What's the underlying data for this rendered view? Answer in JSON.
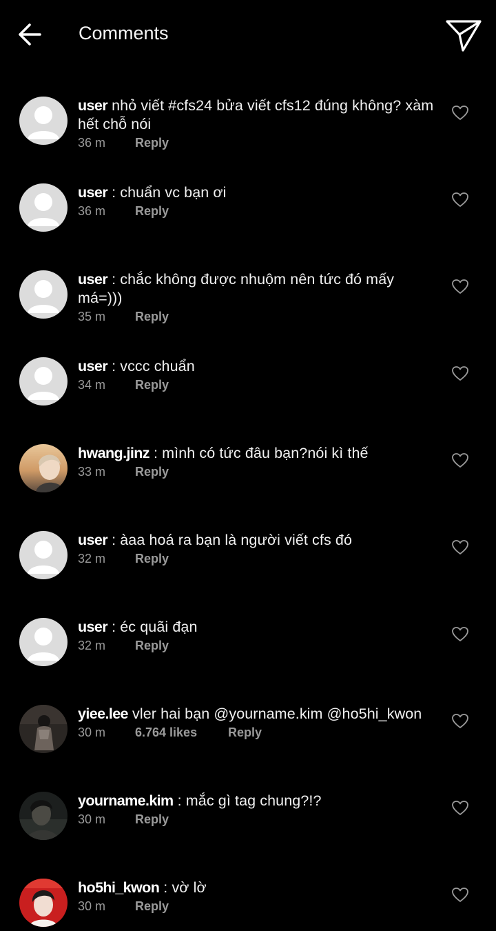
{
  "header": {
    "title": "Comments",
    "back_icon": "arrow-left-icon",
    "share_icon": "paper-plane-icon"
  },
  "comments": [
    {
      "username": "user",
      "text": " nhỏ viết #cfs24 bửa viết cfs12 đúng không? xàm hết chỗ nói",
      "time": "36 m",
      "likes": "",
      "reply": "Reply",
      "avatar": "default"
    },
    {
      "username": "user",
      "text": " : chuẩn vc bạn ơi",
      "time": "36 m",
      "likes": "",
      "reply": "Reply",
      "avatar": "default"
    },
    {
      "username": "user",
      "text": " : chắc không được nhuộm nên tức đó mấy má=)))",
      "time": "35 m",
      "likes": "",
      "reply": "Reply",
      "avatar": "default"
    },
    {
      "username": "user",
      "text": " : vccc chuẩn",
      "time": "34 m",
      "likes": "",
      "reply": "Reply",
      "avatar": "default"
    },
    {
      "username": "hwang.jinz",
      "text": " : mình có tức đâu bạn?nói kì thế",
      "time": "33 m",
      "likes": "",
      "reply": "Reply",
      "avatar": "photo-sunset"
    },
    {
      "username": "user",
      "text": " : àaa hoá ra bạn là người viết cfs đó",
      "time": "32 m",
      "likes": "",
      "reply": "Reply",
      "avatar": "default"
    },
    {
      "username": "user",
      "text": " : éc quãi đạn",
      "time": "32 m",
      "likes": "",
      "reply": "Reply",
      "avatar": "default"
    },
    {
      "username": "yiee.lee",
      "text": " vler hai bạn @yourname.kim @ho5hi_kwon",
      "time": "30 m",
      "likes": "6.764 likes",
      "reply": "Reply",
      "avatar": "photo-dark"
    },
    {
      "username": "yourname.kim",
      "text": " : mắc gì tag chung?!?",
      "time": "30 m",
      "likes": "",
      "reply": "Reply",
      "avatar": "photo-dim"
    },
    {
      "username": "ho5hi_kwon",
      "text": " : vờ lờ",
      "time": "30 m",
      "likes": "",
      "reply": "Reply",
      "avatar": "photo-red"
    }
  ],
  "colors": {
    "background": "#000000",
    "text": "#f0f0f0",
    "meta": "#9a9a9a",
    "default_avatar": "#dcdcdc"
  }
}
